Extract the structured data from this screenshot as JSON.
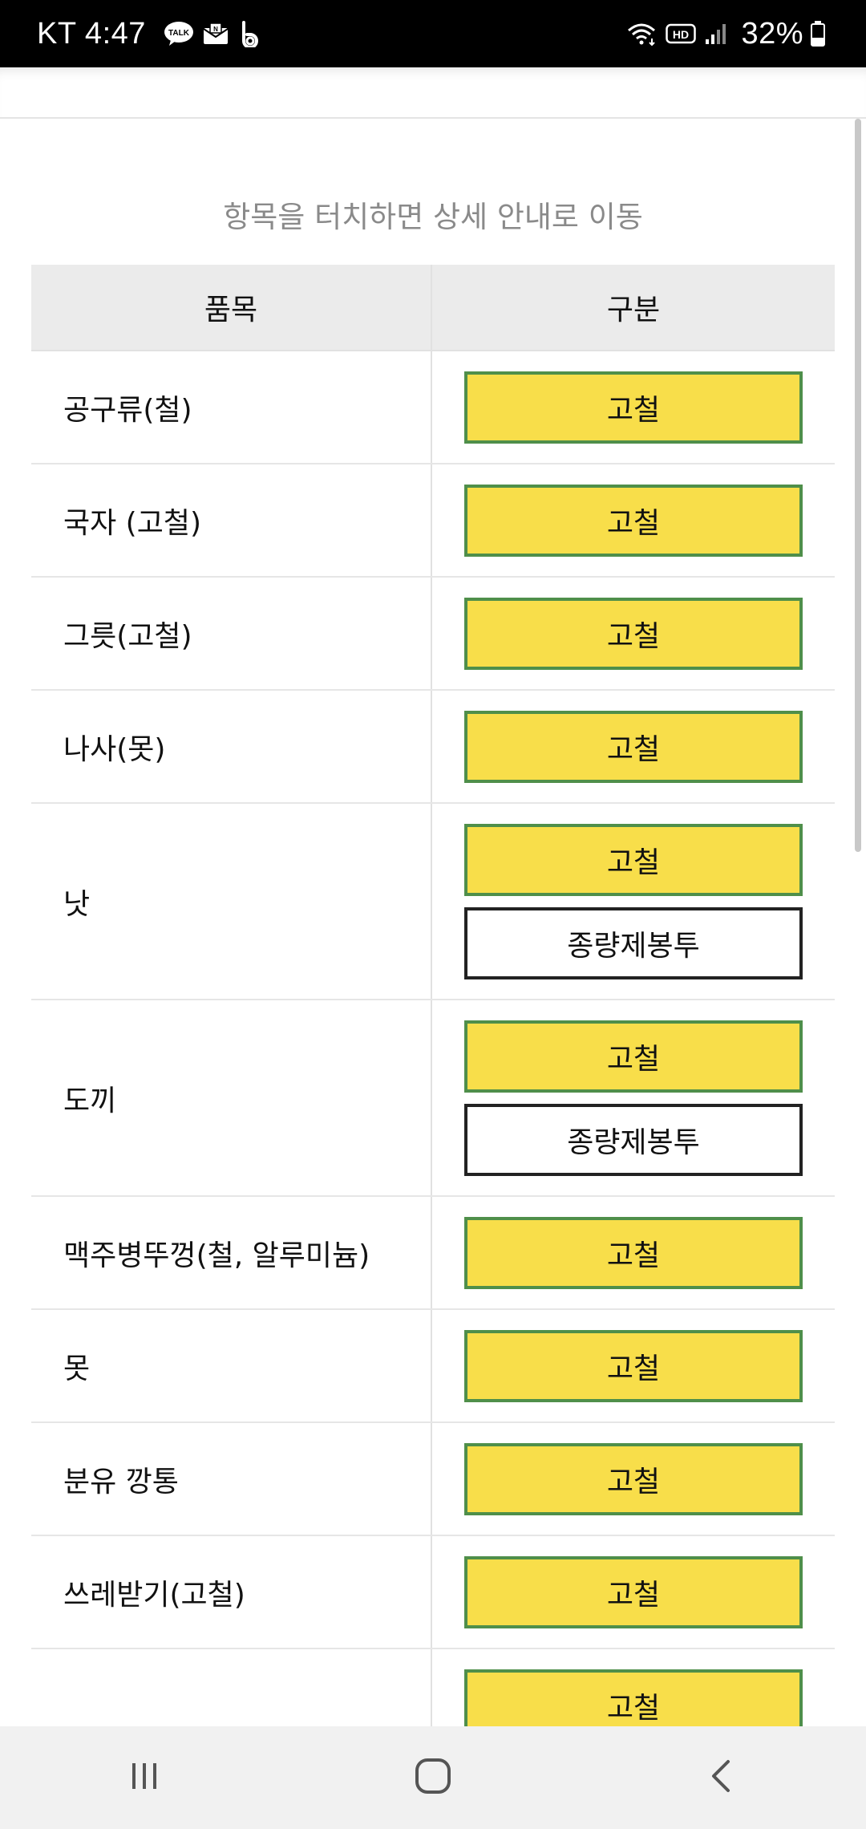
{
  "status_bar": {
    "carrier_time": "KT 4:47",
    "left_icons": [
      "kakaotalk-icon",
      "mail-icon",
      "band-icon"
    ],
    "right_icons": [
      "wifi-icon",
      "hd-icon",
      "signal-icon"
    ],
    "battery": "32%"
  },
  "page": {
    "hint": "항목을 터치하면 상세 안내로 이동"
  },
  "table": {
    "headers": {
      "item": "품목",
      "type": "구분"
    },
    "rows": [
      {
        "item": "공구류(철)",
        "types": [
          "고철"
        ]
      },
      {
        "item": "국자 (고철)",
        "types": [
          "고철"
        ]
      },
      {
        "item": "그릇(고철)",
        "types": [
          "고철"
        ]
      },
      {
        "item": "나사(못)",
        "types": [
          "고철"
        ]
      },
      {
        "item": "낫",
        "types": [
          "고철",
          "종량제봉투"
        ]
      },
      {
        "item": "도끼",
        "types": [
          "고철",
          "종량제봉투"
        ]
      },
      {
        "item": "맥주병뚜껑(철, 알루미늄)",
        "types": [
          "고철"
        ]
      },
      {
        "item": "못",
        "types": [
          "고철"
        ]
      },
      {
        "item": "분유 깡통",
        "types": [
          "고철"
        ]
      },
      {
        "item": "쓰레받기(고철)",
        "types": [
          "고철"
        ]
      },
      {
        "item": "",
        "types": [
          "고철"
        ]
      }
    ]
  },
  "colors": {
    "tag_yellow_bg": "#f8de4a",
    "tag_yellow_border": "#4f8f4a",
    "tag_white_border": "#222222",
    "header_bg": "#ebebeb"
  },
  "nav_bar": {
    "icons": [
      "recent-apps-icon",
      "home-icon",
      "back-icon"
    ]
  }
}
